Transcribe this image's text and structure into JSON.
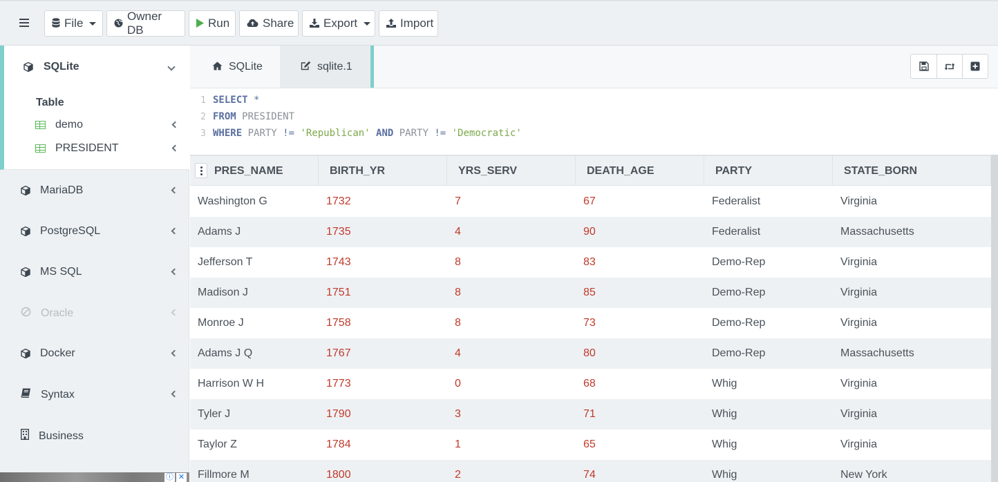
{
  "toolbar": {
    "file": "File",
    "owner_db": "Owner DB",
    "run": "Run",
    "share": "Share",
    "export": "Export",
    "import": "Import"
  },
  "sidebar": {
    "active_db": "SQLite",
    "table_heading": "Table",
    "tables": [
      "demo",
      "PRESIDENT"
    ],
    "items": [
      {
        "label": "MariaDB",
        "icon": "cube-icon"
      },
      {
        "label": "PostgreSQL",
        "icon": "cube-icon"
      },
      {
        "label": "MS SQL",
        "icon": "cube-icon"
      },
      {
        "label": "Oracle",
        "icon": "ban-icon",
        "disabled": true
      },
      {
        "label": "Docker",
        "icon": "cube-icon"
      },
      {
        "label": "Syntax",
        "icon": "book-icon"
      },
      {
        "label": "Business",
        "icon": "building-icon"
      }
    ]
  },
  "tabs": {
    "home": "SQLite",
    "query": "sqlite.1"
  },
  "editor": {
    "line_numbers": [
      "1",
      "2",
      "3"
    ],
    "l1_kw": "SELECT",
    "l1_rest": " *",
    "l2_kw": "FROM",
    "l2_rest": " PRESIDENT",
    "l3_kw1": "WHERE",
    "l3_col1": " PARTY ",
    "l3_op1": "!=",
    "l3_str1": " 'Republican'",
    "l3_kw2": " AND",
    "l3_col2": " PARTY ",
    "l3_op2": "!=",
    "l3_str2": " 'Democratic'"
  },
  "grid": {
    "columns": [
      "PRES_NAME",
      "BIRTH_YR",
      "YRS_SERV",
      "DEATH_AGE",
      "PARTY",
      "STATE_BORN"
    ],
    "rows": [
      [
        "Washington G",
        "1732",
        "7",
        "67",
        "Federalist",
        "Virginia"
      ],
      [
        "Adams J",
        "1735",
        "4",
        "90",
        "Federalist",
        "Massachusetts"
      ],
      [
        "Jefferson T",
        "1743",
        "8",
        "83",
        "Demo-Rep",
        "Virginia"
      ],
      [
        "Madison J",
        "1751",
        "8",
        "85",
        "Demo-Rep",
        "Virginia"
      ],
      [
        "Monroe J",
        "1758",
        "8",
        "73",
        "Demo-Rep",
        "Virginia"
      ],
      [
        "Adams J Q",
        "1767",
        "4",
        "80",
        "Demo-Rep",
        "Massachusetts"
      ],
      [
        "Harrison W H",
        "1773",
        "0",
        "68",
        "Whig",
        "Virginia"
      ],
      [
        "Tyler J",
        "1790",
        "3",
        "71",
        "Whig",
        "Virginia"
      ],
      [
        "Taylor Z",
        "1784",
        "1",
        "65",
        "Whig",
        "Virginia"
      ],
      [
        "Fillmore M",
        "1800",
        "2",
        "74",
        "Whig",
        "New York"
      ]
    ]
  },
  "colors": {
    "accent": "#7fcfcc",
    "number_text": "#c0392b",
    "sql_keyword": "#5a6fa0",
    "sql_string": "#7ca84a"
  }
}
